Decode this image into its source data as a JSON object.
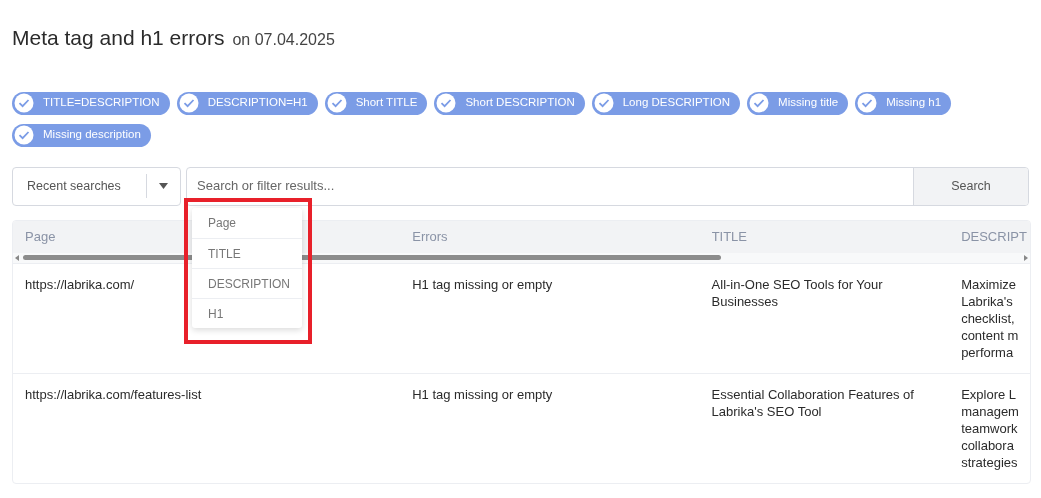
{
  "heading": {
    "title": "Meta tag and h1 errors",
    "date": "on 07.04.2025"
  },
  "filters": [
    {
      "label": "TITLE=DESCRIPTION",
      "checked": true
    },
    {
      "label": "DESCRIPTION=H1",
      "checked": true
    },
    {
      "label": "Short TITLE",
      "checked": true
    },
    {
      "label": "Short DESCRIPTION",
      "checked": true
    },
    {
      "label": "Long DESCRIPTION",
      "checked": true
    },
    {
      "label": "Missing title",
      "checked": true
    },
    {
      "label": "Missing h1",
      "checked": true
    },
    {
      "label": "Missing description",
      "checked": true
    }
  ],
  "search": {
    "recent": "Recent searches",
    "placeholder": "Search or filter results...",
    "button": "Search"
  },
  "field_menu": [
    "Page",
    "TITLE",
    "DESCRIPTION",
    "H1"
  ],
  "table": {
    "columns": [
      "Page",
      "Errors",
      "TITLE",
      "DESCRIPT"
    ],
    "rows": [
      {
        "page": "https://labrika.com/",
        "errors": "H1 tag missing or empty",
        "title": "All-in-One SEO Tools for Your Businesses",
        "description": [
          "Maximize",
          "Labrika's",
          "checklist,",
          "content m",
          "performa"
        ]
      },
      {
        "page": "https://labrika.com/features-list",
        "errors": "H1 tag missing or empty",
        "title": "Essential Collaboration Features of Labrika's SEO Tool",
        "description": [
          "Explore L",
          "managem",
          "teamwork",
          "collabora",
          "strategies"
        ]
      }
    ]
  }
}
